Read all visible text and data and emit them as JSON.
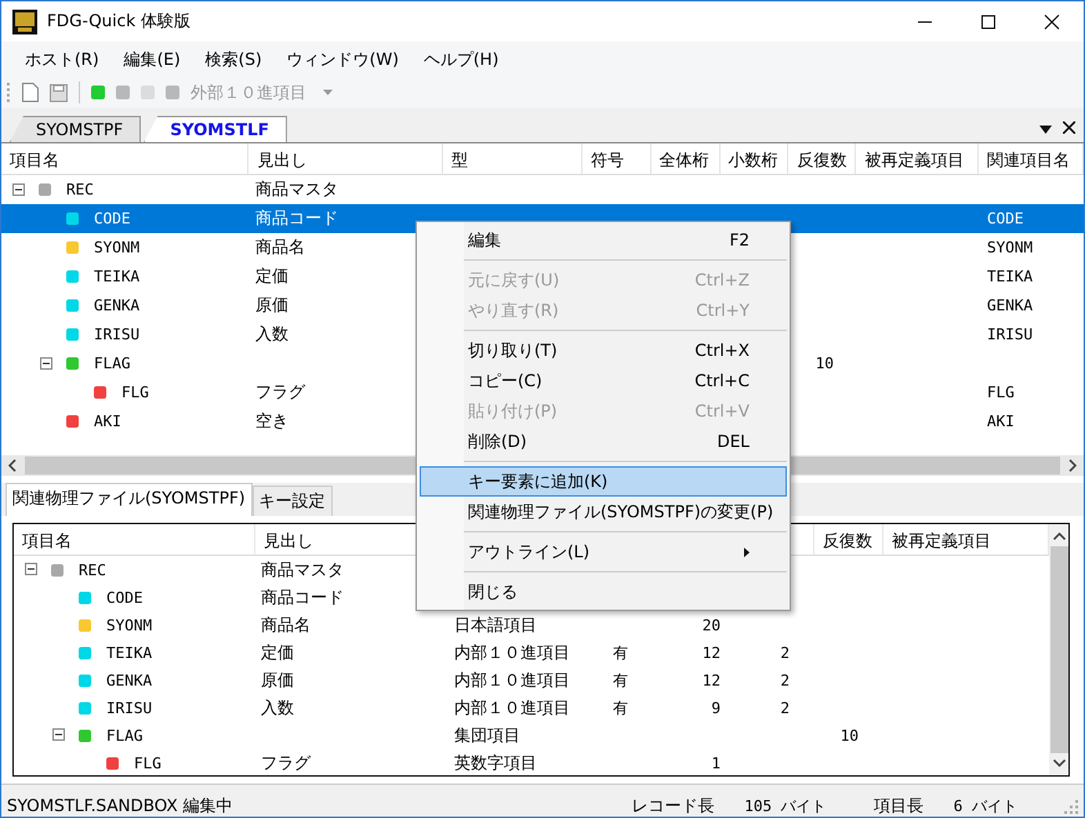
{
  "window": {
    "title": "FDG-Quick 体験版"
  },
  "menu_bar": [
    "ホスト(R)",
    "編集(E)",
    "検索(S)",
    "ウィンドウ(W)",
    "ヘルプ(H)"
  ],
  "toolbar": {
    "type_combo": {
      "value": "外部１０進項目",
      "disabled": true
    }
  },
  "tabs": [
    {
      "label": "SYOMSTPF",
      "selected": false
    },
    {
      "label": "SYOMSTLF",
      "selected": true
    }
  ],
  "upper_table": {
    "columns": [
      "項目名",
      "見出し",
      "型",
      "符号",
      "全体桁",
      "小数桁",
      "反復数",
      "被再定義項目",
      "関連項目名"
    ],
    "rows": [
      {
        "name": "REC",
        "heading": "商品マスタ",
        "color": "#a8a8a8",
        "selected": false,
        "expanded": true,
        "cells": [
          null,
          null,
          null,
          null,
          null,
          null,
          null
        ],
        "children": [
          {
            "name": "CODE",
            "heading": "商品コード",
            "color": "#00d8e8",
            "selected": true,
            "cells": [
              null,
              null,
              null,
              null,
              null,
              null,
              "CODE"
            ]
          },
          {
            "name": "SYONM",
            "heading": "商品名",
            "color": "#f8c830",
            "selected": false,
            "cells": [
              null,
              null,
              null,
              null,
              null,
              null,
              "SYONM"
            ]
          },
          {
            "name": "TEIKA",
            "heading": "定価",
            "color": "#00d8e8",
            "selected": false,
            "cells": [
              null,
              null,
              null,
              null,
              null,
              null,
              "TEIKA"
            ]
          },
          {
            "name": "GENKA",
            "heading": "原価",
            "color": "#00d8e8",
            "selected": false,
            "cells": [
              null,
              null,
              null,
              null,
              null,
              null,
              "GENKA"
            ]
          },
          {
            "name": "IRISU",
            "heading": "入数",
            "color": "#00d8e8",
            "selected": false,
            "cells": [
              null,
              null,
              null,
              null,
              null,
              null,
              "IRISU"
            ]
          },
          {
            "name": "FLAG",
            "color": "#30c830",
            "selected": false,
            "expanded": true,
            "cells": [
              null,
              null,
              null,
              null,
              "10",
              null,
              null
            ],
            "children": [
              {
                "name": "FLG",
                "heading": "フラグ",
                "color": "#f04040",
                "selected": false,
                "cells": [
                  null,
                  null,
                  null,
                  null,
                  null,
                  null,
                  "FLG"
                ]
              }
            ]
          },
          {
            "name": "AKI",
            "heading": "空き",
            "color": "#f04040",
            "selected": false,
            "cells": [
              null,
              null,
              null,
              null,
              null,
              null,
              "AKI"
            ]
          }
        ]
      }
    ]
  },
  "lower_tabs": [
    {
      "label": "関連物理ファイル(SYOMSTPF)",
      "selected": true
    },
    {
      "label": "キー設定",
      "selected": false
    }
  ],
  "lower_table": {
    "columns": [
      "項目名",
      "見出し",
      null,
      null,
      null,
      null,
      "反復数",
      "被再定義項目"
    ],
    "rows": [
      {
        "name": "REC",
        "heading": "商品マスタ",
        "color": "#a8a8a8",
        "expanded": true,
        "cells": [
          null,
          null,
          null,
          null,
          null,
          null
        ],
        "children": [
          {
            "name": "CODE",
            "heading": "商品コード",
            "color": "#00d8e8",
            "cells": [
              null,
              null,
              null,
              null,
              null,
              null
            ]
          },
          {
            "name": "SYONM",
            "heading": "商品名",
            "color": "#f8c830",
            "cells": [
              "日本語項目",
              null,
              "20",
              null,
              null,
              null
            ]
          },
          {
            "name": "TEIKA",
            "heading": "定価",
            "color": "#00d8e8",
            "cells": [
              "内部１０進項目",
              "有",
              "12",
              "2",
              null,
              null
            ]
          },
          {
            "name": "GENKA",
            "heading": "原価",
            "color": "#00d8e8",
            "cells": [
              "内部１０進項目",
              "有",
              "12",
              "2",
              null,
              null
            ]
          },
          {
            "name": "IRISU",
            "heading": "入数",
            "color": "#00d8e8",
            "cells": [
              "内部１０進項目",
              "有",
              "9",
              "2",
              null,
              null
            ]
          },
          {
            "name": "FLAG",
            "color": "#30c830",
            "expanded": true,
            "cells": [
              "集団項目",
              null,
              null,
              null,
              "10",
              null
            ],
            "children": [
              {
                "name": "FLG",
                "heading": "フラグ",
                "color": "#f04040",
                "cells": [
                  "英数字項目",
                  null,
                  "1",
                  null,
                  null,
                  null
                ]
              }
            ]
          }
        ]
      }
    ]
  },
  "context_menu": [
    {
      "kind": "item",
      "label": "編集",
      "shortcut": "F2",
      "disabled": false,
      "selected": false
    },
    {
      "kind": "separator"
    },
    {
      "kind": "item",
      "label": "元に戻す(U)",
      "shortcut": "Ctrl+Z",
      "disabled": true,
      "selected": false
    },
    {
      "kind": "item",
      "label": "やり直す(R)",
      "shortcut": "Ctrl+Y",
      "disabled": true,
      "selected": false
    },
    {
      "kind": "separator"
    },
    {
      "kind": "item",
      "label": "切り取り(T)",
      "shortcut": "Ctrl+X",
      "disabled": false,
      "selected": false
    },
    {
      "kind": "item",
      "label": "コピー(C)",
      "shortcut": "Ctrl+C",
      "disabled": false,
      "selected": false
    },
    {
      "kind": "item",
      "label": "貼り付け(P)",
      "shortcut": "Ctrl+V",
      "disabled": true,
      "selected": false
    },
    {
      "kind": "item",
      "label": "削除(D)",
      "shortcut": "DEL",
      "disabled": false,
      "selected": false
    },
    {
      "kind": "separator"
    },
    {
      "kind": "item",
      "label": "キー要素に追加(K)",
      "disabled": false,
      "selected": true
    },
    {
      "kind": "item",
      "label": "関連物理ファイル(SYOMSTPF)の変更(P)",
      "disabled": false,
      "selected": false
    },
    {
      "kind": "separator"
    },
    {
      "kind": "item",
      "label": "アウトライン(L)",
      "disabled": false,
      "selected": false,
      "submenu": true
    },
    {
      "kind": "separator"
    },
    {
      "kind": "item",
      "label": "閉じる",
      "disabled": false,
      "selected": false
    }
  ],
  "status_bar": {
    "message": "SYOMSTLF.SANDBOX 編集中",
    "record_length_label": "レコード長",
    "record_length": "105 バイト",
    "item_length_label": "項目長",
    "item_length": "6 バイト"
  }
}
